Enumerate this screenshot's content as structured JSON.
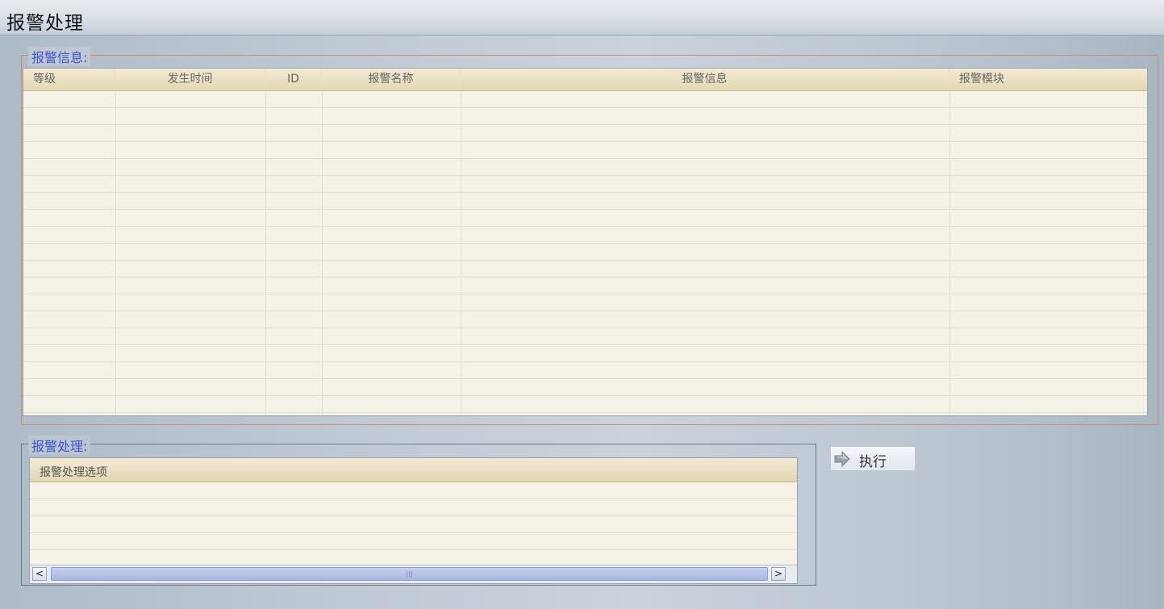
{
  "window": {
    "title": "报警处理"
  },
  "alarm_info": {
    "legend": "报警信息:",
    "columns": [
      "等级",
      "发生时间",
      "ID",
      "报警名称",
      "报警信息",
      "报警模块"
    ]
  },
  "alarm_handling": {
    "legend": "报警处理:",
    "list_header": "报警处理选项",
    "scroll_left": "<",
    "scroll_right": ">"
  },
  "execute_button": {
    "label": "执行",
    "icon": "arrow-right-icon"
  }
}
